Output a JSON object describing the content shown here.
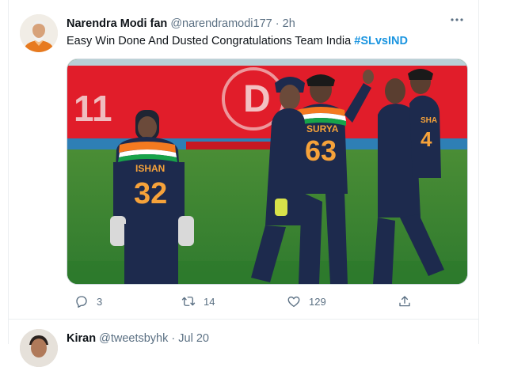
{
  "tweet": {
    "display_name": "Narendra Modi fan",
    "handle": "@narendramodi177",
    "separator": "·",
    "time": "2h",
    "text": "Easy Win Done And Dusted Congratulations Team India ",
    "hashtag": "#SLvsIND",
    "media": {
      "player_left_name": "ISHAN",
      "player_left_number": "32",
      "player_center_name": "SURYA",
      "player_center_number": "63",
      "player_right_name": "SHA",
      "player_right_number": "4",
      "board_left_text": "11",
      "board_right_text": "D"
    },
    "actions": {
      "reply_count": "3",
      "retweet_count": "14",
      "like_count": "129"
    }
  },
  "next_tweet": {
    "display_name": "Kiran",
    "handle": "@tweetsbyhk",
    "separator": "·",
    "time": "Jul 20"
  },
  "colors": {
    "text": "#0f1419",
    "secondary": "#5b7083",
    "hashtag": "#1b95e0",
    "border": "#ebeef0"
  },
  "icons": {
    "reply": "reply-icon",
    "retweet": "retweet-icon",
    "like": "like-icon",
    "share": "share-icon",
    "more": "more-icon"
  }
}
